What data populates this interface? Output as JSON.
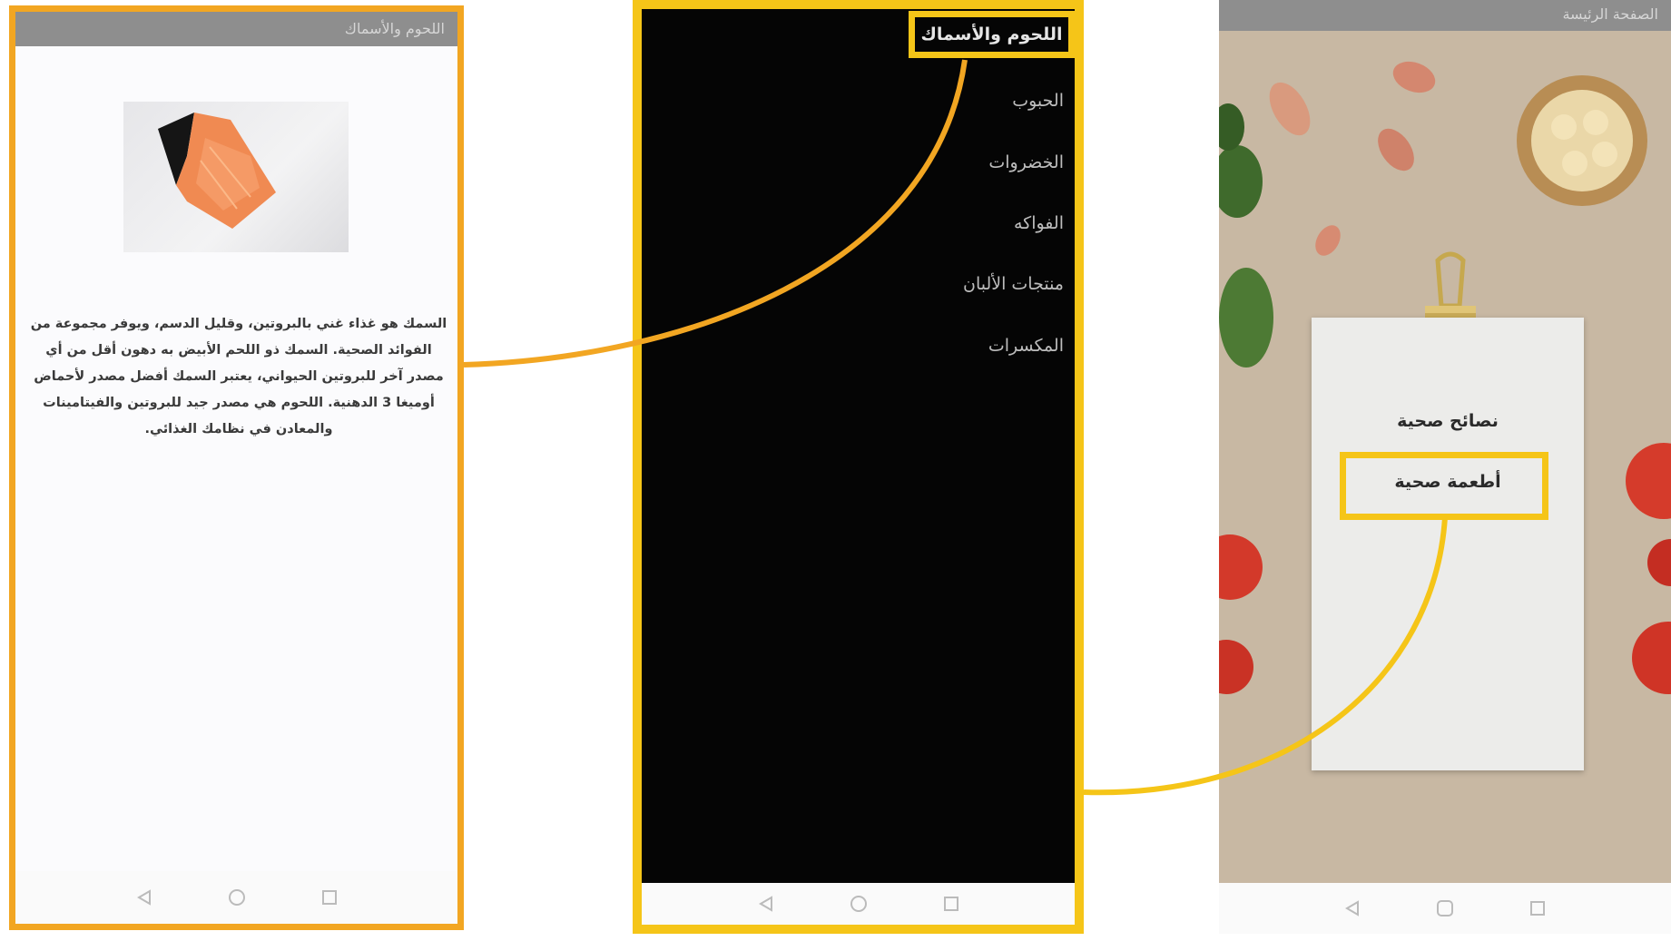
{
  "screens": {
    "detail": {
      "appbar_title": "اللحوم والأسماك",
      "photo_icon": "salmon-fillet-photo",
      "description": "السمك هو غذاء غني بالبروتين، وقليل الدسم، ويوفر مجموعة من الفوائد الصحية. السمك ذو اللحم الأبيض به دهون أقل من أي مصدر آخر للبروتين الحيواني، يعتبر السمك أفضل مصدر لأحماض أوميغا 3 الدهنية. اللحوم هي مصدر جيد للبروتين والفيتامينات والمعادن في نظامك الغذائي."
    },
    "menu": {
      "items": [
        {
          "label": "اللحوم والأسماك",
          "selected": true
        },
        {
          "label": "الحبوب",
          "selected": false
        },
        {
          "label": "الخضروات",
          "selected": false
        },
        {
          "label": "الفواكه",
          "selected": false
        },
        {
          "label": "منتجات الألبان",
          "selected": false
        },
        {
          "label": "المكسرات",
          "selected": false
        }
      ]
    },
    "home": {
      "appbar_title": "الصفحة الرئيسة",
      "links": [
        {
          "label": "نصائح صحية"
        },
        {
          "label": "أطعمة صحية"
        }
      ]
    }
  },
  "icons": {
    "back": "back-triangle-icon",
    "home": "home-circle-icon",
    "recent": "recent-square-icon"
  },
  "colors": {
    "highlight_orange": "#f2a622",
    "highlight_yellow": "#f5c518",
    "menu_background": "#050505",
    "appbar": "#8e8e8e"
  }
}
